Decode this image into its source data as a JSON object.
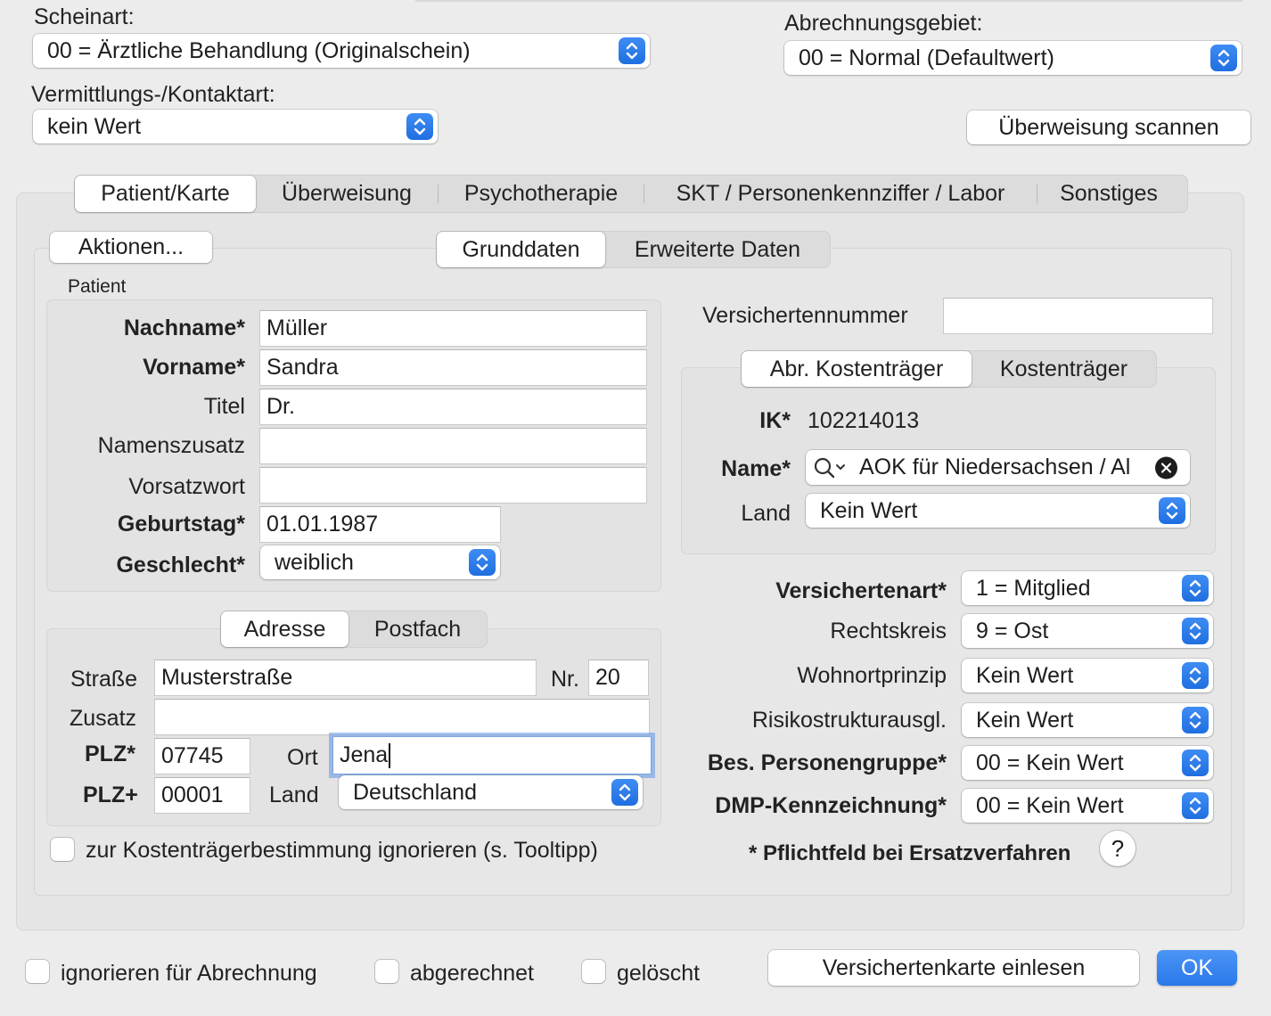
{
  "top": {
    "scheinart_label": "Scheinart:",
    "scheinart_value": "00 = Ärztliche Behandlung (Originalschein)",
    "abrechnungsgebiet_label": "Abrechnungsgebiet:",
    "abrechnungsgebiet_value": "00 = Normal (Defaultwert)",
    "vermittlung_label": "Vermittlungs-/Kontaktart:",
    "vermittlung_value": "kein Wert",
    "scan_button": "Überweisung scannen"
  },
  "main_tabs": [
    {
      "label": "Patient/Karte",
      "selected": true
    },
    {
      "label": "Überweisung",
      "selected": false
    },
    {
      "label": "Psychotherapie",
      "selected": false
    },
    {
      "label": "SKT / Personenkennziffer / Labor",
      "selected": false
    },
    {
      "label": "Sonstiges",
      "selected": false
    }
  ],
  "actions_button": "Aktionen...",
  "sub_tabs": [
    {
      "label": "Grunddaten",
      "selected": true
    },
    {
      "label": "Erweiterte Daten",
      "selected": false
    }
  ],
  "patient": {
    "group_label": "Patient",
    "nachname_label": "Nachname*",
    "nachname_value": "Müller",
    "vorname_label": "Vorname*",
    "vorname_value": "Sandra",
    "titel_label": "Titel",
    "titel_value": "Dr.",
    "namenszusatz_label": "Namenszusatz",
    "namenszusatz_value": "",
    "vorsatzwort_label": "Vorsatzwort",
    "vorsatzwort_value": "",
    "geburtstag_label": "Geburtstag*",
    "geburtstag_value": "01.01.1987",
    "geschlecht_label": "Geschlecht*",
    "geschlecht_value": "weiblich"
  },
  "address_tabs": [
    {
      "label": "Adresse",
      "selected": true
    },
    {
      "label": "Postfach",
      "selected": false
    }
  ],
  "address": {
    "strasse_label": "Straße",
    "strasse_value": "Musterstraße",
    "nr_label": "Nr.",
    "nr_value": "20",
    "zusatz_label": "Zusatz",
    "zusatz_value": "",
    "plz_label": "PLZ*",
    "plz_value": "07745",
    "ort_label": "Ort",
    "ort_value": "Jena",
    "plzplus_label": "PLZ+",
    "plzplus_value": "00001",
    "land_label": "Land",
    "land_value": "Deutschland"
  },
  "ignore_cost_checkbox": "zur Kostenträgerbestimmung ignorieren (s. Tooltipp)",
  "insurance": {
    "versichertennummer_label": "Versichertennummer",
    "versichertennummer_value": "",
    "tabs": [
      {
        "label": "Abr. Kostenträger",
        "selected": true
      },
      {
        "label": "Kostenträger",
        "selected": false
      }
    ],
    "ik_label": "IK*",
    "ik_value": "102214013",
    "name_label": "Name*",
    "name_value": "AOK für Niedersachsen / Al",
    "land_label": "Land",
    "land_value": "Kein Wert",
    "versichertenart_label": "Versichertenart*",
    "versichertenart_value": "1 = Mitglied",
    "rechtskreis_label": "Rechtskreis",
    "rechtskreis_value": "9 = Ost",
    "wohnortprinzip_label": "Wohnortprinzip",
    "wohnortprinzip_value": "Kein Wert",
    "risiko_label": "Risikostrukturausgl.",
    "risiko_value": "Kein Wert",
    "personengruppe_label": "Bes. Personengruppe*",
    "personengruppe_value": "00 = Kein Wert",
    "dmp_label": "DMP-Kennzeichnung*",
    "dmp_value": "00 = Kein Wert",
    "pflicht_note": "* Pflichtfeld bei Ersatzverfahren",
    "help_glyph": "?"
  },
  "footer": {
    "ignore_billing": "ignorieren für Abrechnung",
    "billed": "abgerechnet",
    "deleted": "gelöscht",
    "read_card_button": "Versichertenkarte einlesen",
    "ok_button": "OK"
  },
  "colors": {
    "accent": "#2a78ea",
    "background": "#ececec",
    "focus_ring": "#5f94e8"
  }
}
